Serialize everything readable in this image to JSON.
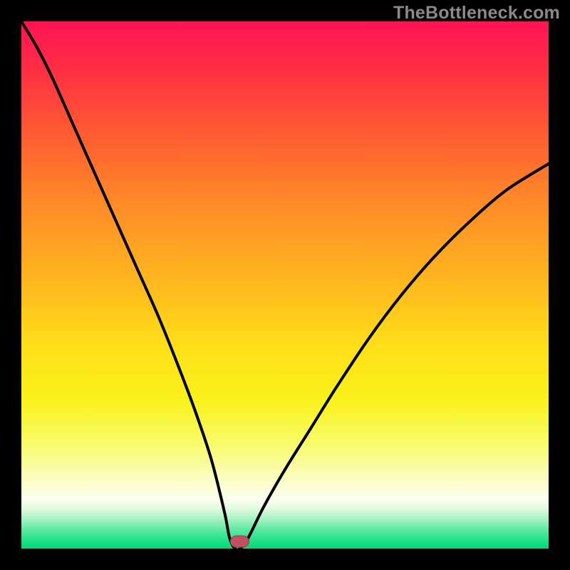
{
  "watermark": "TheBottleneck.com",
  "plot": {
    "inner_x": 30,
    "inner_y": 30,
    "inner_w": 740,
    "inner_h": 740
  },
  "marker": {
    "x_frac": 0.414,
    "fill": "#c05060",
    "stroke": "#a03a4a"
  },
  "gradient_stops": [
    {
      "offset": 0.0,
      "color": "#ff1353"
    },
    {
      "offset": 0.08,
      "color": "#ff2a45"
    },
    {
      "offset": 0.2,
      "color": "#ff5733"
    },
    {
      "offset": 0.35,
      "color": "#ff8c28"
    },
    {
      "offset": 0.5,
      "color": "#ffb91e"
    },
    {
      "offset": 0.62,
      "color": "#ffe019"
    },
    {
      "offset": 0.72,
      "color": "#f9f21b"
    },
    {
      "offset": 0.8,
      "color": "#f9fb6a"
    },
    {
      "offset": 0.86,
      "color": "#fbfdb8"
    },
    {
      "offset": 0.905,
      "color": "#fdfef0"
    },
    {
      "offset": 0.925,
      "color": "#e0fadf"
    },
    {
      "offset": 0.945,
      "color": "#a1f2c0"
    },
    {
      "offset": 0.965,
      "color": "#5de8a1"
    },
    {
      "offset": 0.985,
      "color": "#20e088"
    },
    {
      "offset": 1.0,
      "color": "#00d977"
    }
  ],
  "chart_data": {
    "type": "line",
    "title": "",
    "xlabel": "",
    "ylabel": "",
    "xlim": [
      0,
      1
    ],
    "ylim": [
      0,
      1
    ],
    "grid": false,
    "legend": false,
    "note": "V-shaped bottleneck curve; y≈0 at x≈0.41; background gradient encodes bottleneck severity (red high → green low).",
    "series": [
      {
        "name": "bottleneck-curve",
        "x": [
          0.0,
          0.03,
          0.06,
          0.1,
          0.14,
          0.18,
          0.22,
          0.26,
          0.3,
          0.33,
          0.36,
          0.385,
          0.395,
          0.405,
          0.415,
          0.43,
          0.46,
          0.5,
          0.55,
          0.6,
          0.66,
          0.72,
          0.78,
          0.85,
          0.92,
          1.0
        ],
        "y": [
          1.0,
          0.95,
          0.89,
          0.8,
          0.71,
          0.62,
          0.53,
          0.44,
          0.34,
          0.26,
          0.17,
          0.07,
          0.02,
          0.0,
          0.0,
          0.02,
          0.08,
          0.15,
          0.23,
          0.31,
          0.4,
          0.48,
          0.55,
          0.62,
          0.68,
          0.73
        ]
      }
    ]
  }
}
